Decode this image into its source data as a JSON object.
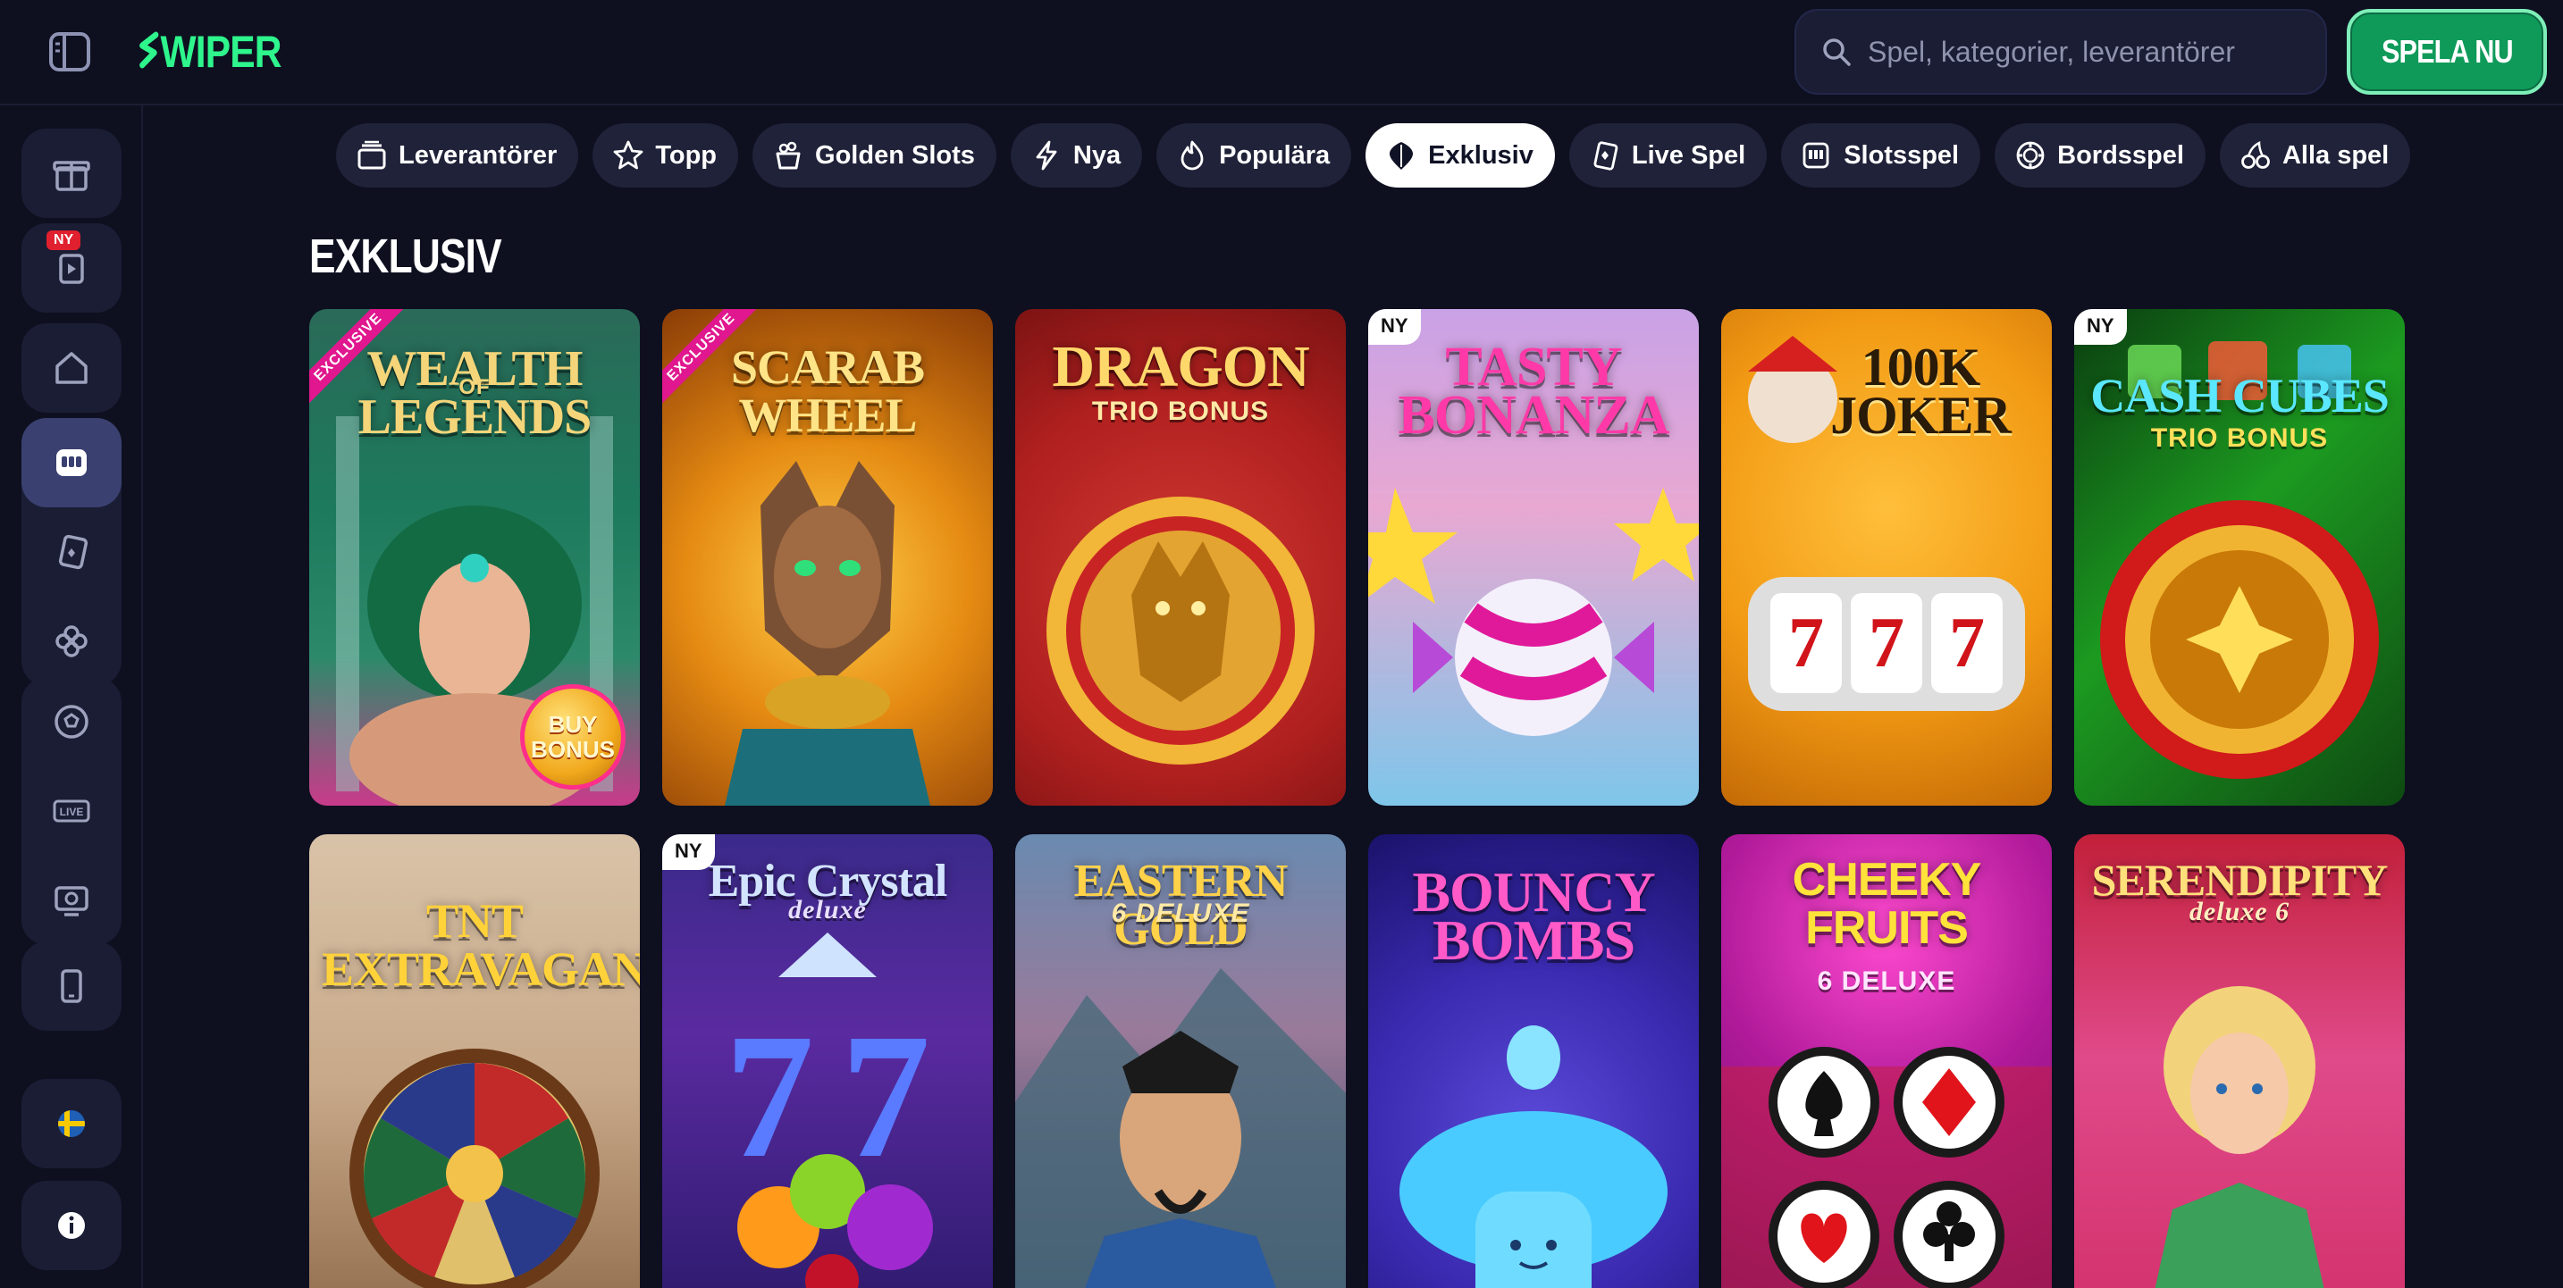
{
  "header": {
    "logo_text": "WIPER",
    "search_placeholder": "Spel, kategorier, leverantörer",
    "play_button": "SPELA NU"
  },
  "rail": {
    "new_badge": "NY",
    "live_label": "LIVE"
  },
  "categories": [
    {
      "label": "Leverantörer",
      "icon": "stack-icon"
    },
    {
      "label": "Topp",
      "icon": "star-icon"
    },
    {
      "label": "Golden Slots",
      "icon": "pot-icon"
    },
    {
      "label": "Nya",
      "icon": "lightning-icon"
    },
    {
      "label": "Populära",
      "icon": "flame-icon"
    },
    {
      "label": "Exklusiv",
      "icon": "diamond-icon",
      "active": true
    },
    {
      "label": "Live Spel",
      "icon": "cards-icon"
    },
    {
      "label": "Slotsspel",
      "icon": "slot-icon"
    },
    {
      "label": "Bordsspel",
      "icon": "chip-icon"
    },
    {
      "label": "Alla spel",
      "icon": "cherries-icon"
    }
  ],
  "section_title": "EXKLUSIV",
  "games": [
    {
      "title": "WEALTH LEGENDS",
      "subtitle": "OF",
      "ribbon": "EXCLUSIVE",
      "badge": "BUY BONUS"
    },
    {
      "title": "SCARAB WHEEL",
      "ribbon": "EXCLUSIVE"
    },
    {
      "title": "DRAGON",
      "subtitle": "TRIO BONUS"
    },
    {
      "title": "TASTY BONANZA",
      "tag": "NY"
    },
    {
      "title": "100K JOKER"
    },
    {
      "title": "CASH CUBES",
      "subtitle": "TRIO BONUS",
      "tag": "NY"
    },
    {
      "title": "TNT EXTRAVAGANZA"
    },
    {
      "title": "Epic Crystal",
      "subtitle": "deluxe",
      "tag": "NY"
    },
    {
      "title": "EASTERN GOLD",
      "subtitle": "6 DELUXE"
    },
    {
      "title": "BOUNCY BOMBS"
    },
    {
      "title": "CHEEKY FRUITS",
      "subtitle": "6 DELUXE"
    },
    {
      "title": "SERENDIPITY",
      "subtitle": "deluxe 6"
    }
  ],
  "colors": {
    "background": "#0e1020",
    "accent_green": "#2ef58c",
    "pill_bg": "#1f2238",
    "rail_bg": "#1a1d34"
  }
}
